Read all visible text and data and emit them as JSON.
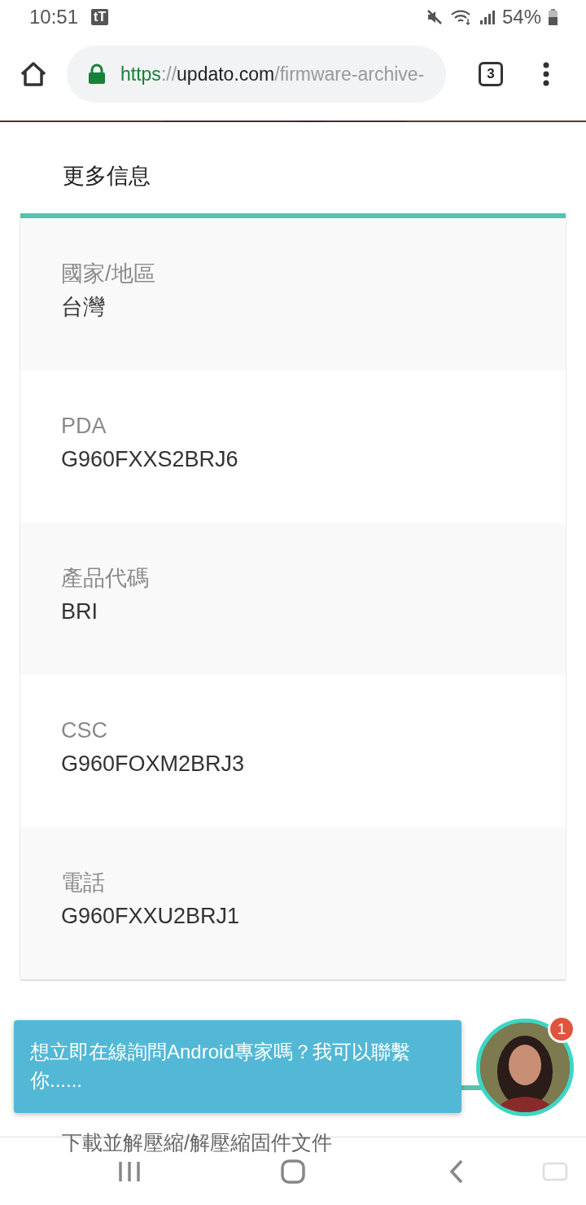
{
  "status_bar": {
    "time": "10:51",
    "app_badge": "tT",
    "battery": "54%"
  },
  "browser": {
    "url": {
      "scheme": "https",
      "separator": "://",
      "host": "updato.com",
      "path": "/firmware-archive-"
    },
    "tab_count": "3"
  },
  "section_title": "更多信息",
  "info_rows": [
    {
      "label": "國家/地區",
      "value": "台灣"
    },
    {
      "label": "PDA",
      "value": "G960FXXS2BRJ6"
    },
    {
      "label": "產品代碼",
      "value": "BRI"
    },
    {
      "label": "CSC",
      "value": "G960FOXM2BRJ3"
    },
    {
      "label": "電話",
      "value": "G960FXXU2BRJ1"
    }
  ],
  "chat": {
    "message": "想立即在線詢問Android專家嗎？我可以聯繫你......",
    "unread_count": "1"
  },
  "next_section_title": "下載並解壓縮/解壓縮固件文件"
}
